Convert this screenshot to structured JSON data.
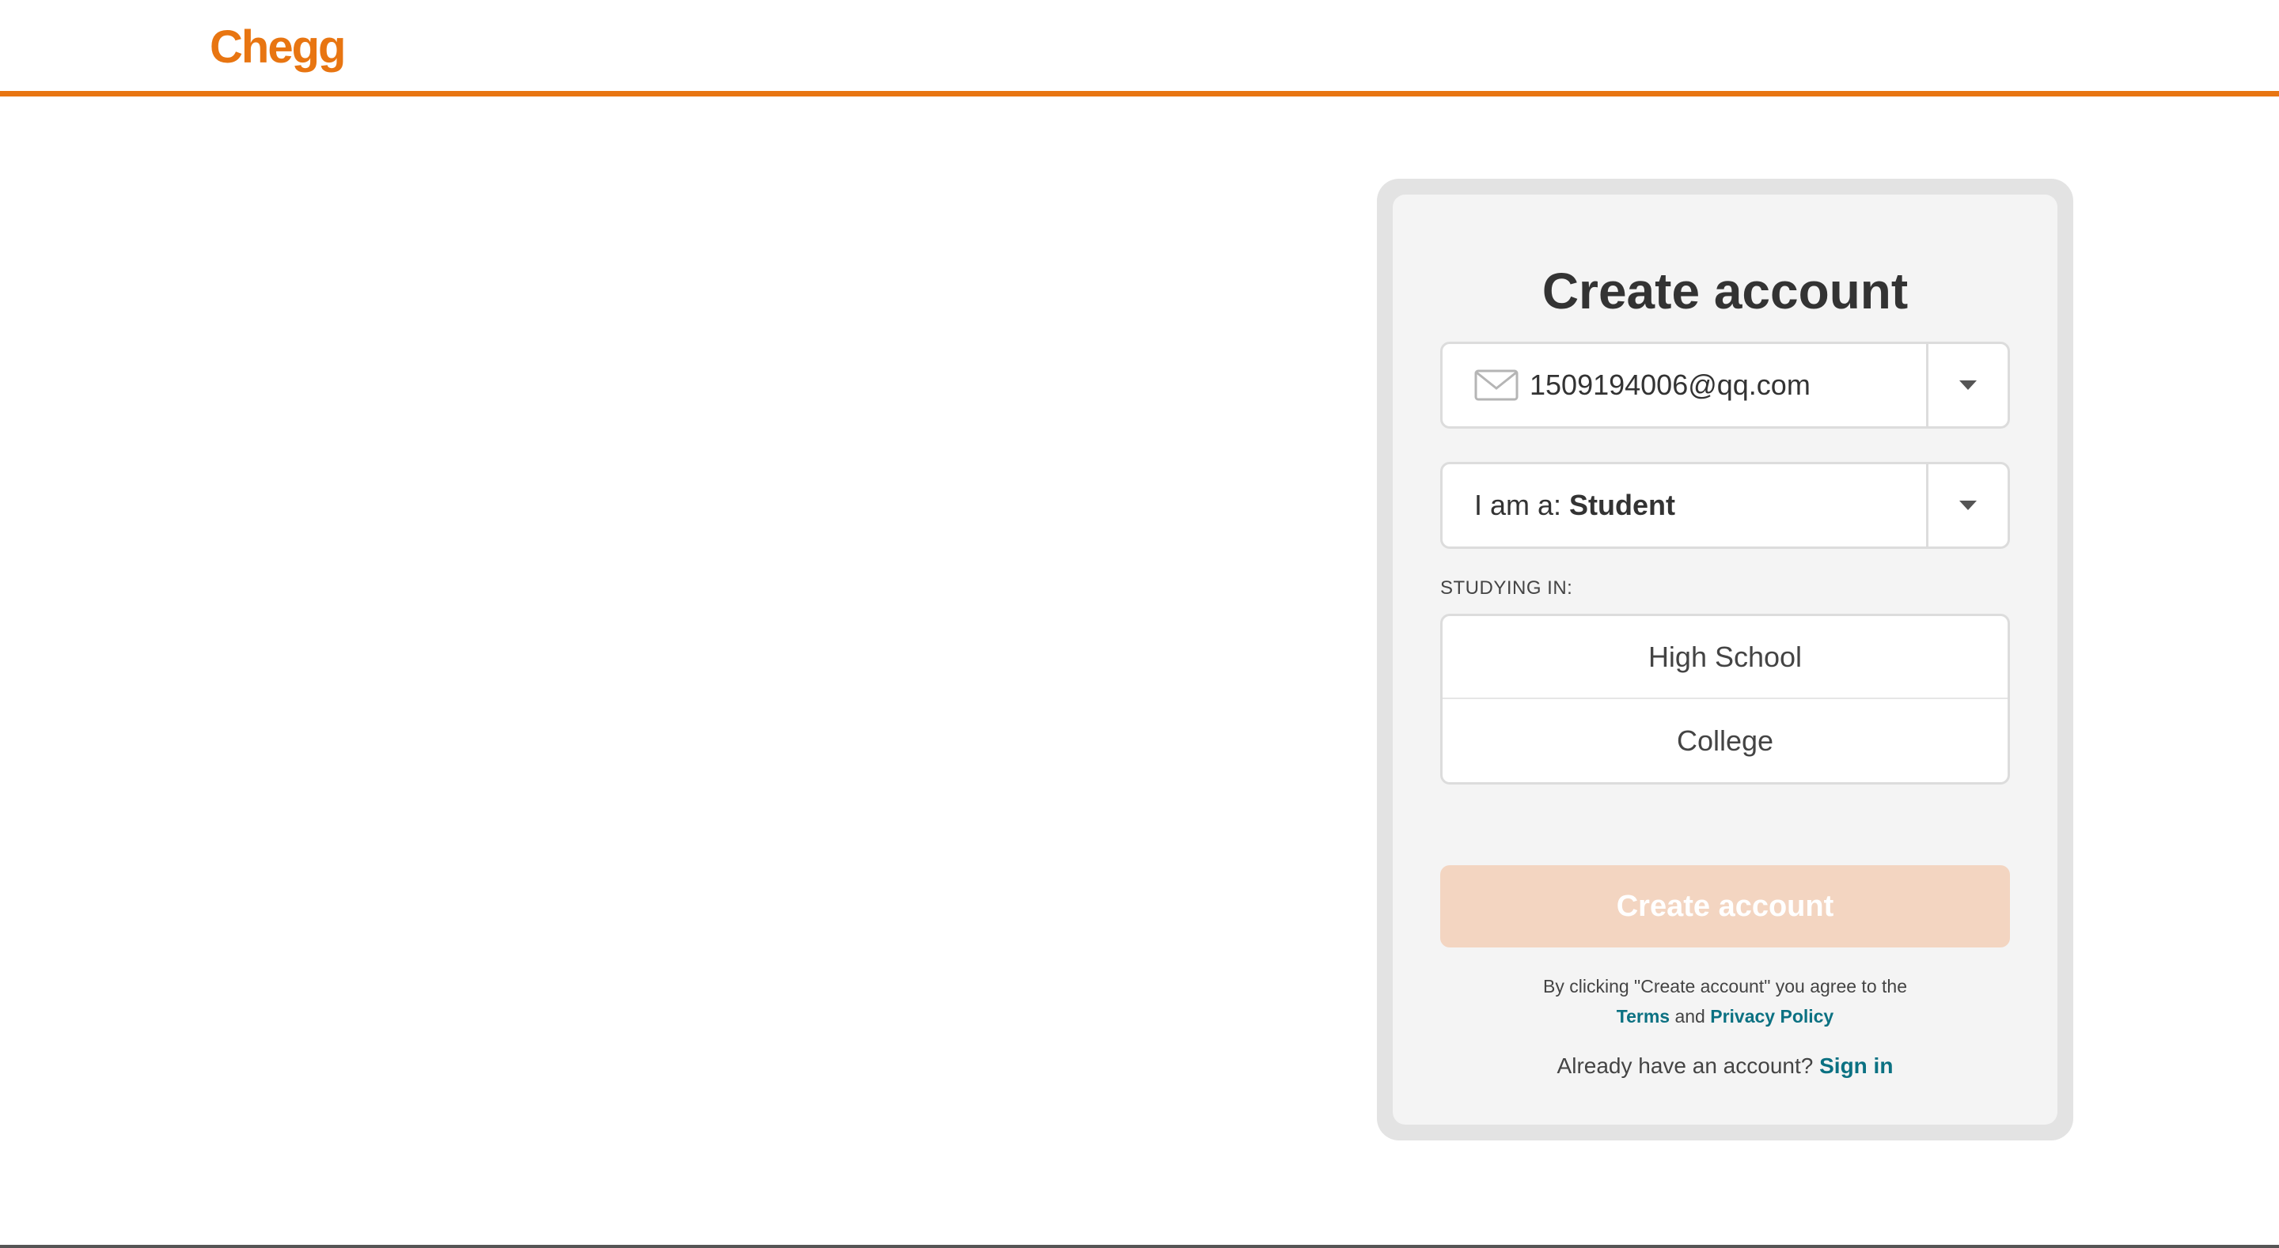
{
  "header": {
    "logo_text": "Chegg"
  },
  "form": {
    "title": "Create account",
    "email": {
      "value": "1509194006@qq.com",
      "icon": "mail-icon"
    },
    "role": {
      "prefix": "I am a:",
      "value": "Student"
    },
    "studying_in": {
      "label": "STUDYING IN:",
      "options": [
        "High School",
        "College"
      ]
    },
    "submit_label": "Create account",
    "legal": {
      "prefix": "By clicking \"Create account\" you agree to the",
      "terms_label": "Terms",
      "conjunction": "and",
      "privacy_label": "Privacy Policy"
    },
    "signin": {
      "prompt": "Already have an account?",
      "link_label": "Sign in"
    }
  },
  "colors": {
    "brand": "#e87511",
    "button_disabled": "#f3d5c1",
    "link": "#0b7182"
  }
}
